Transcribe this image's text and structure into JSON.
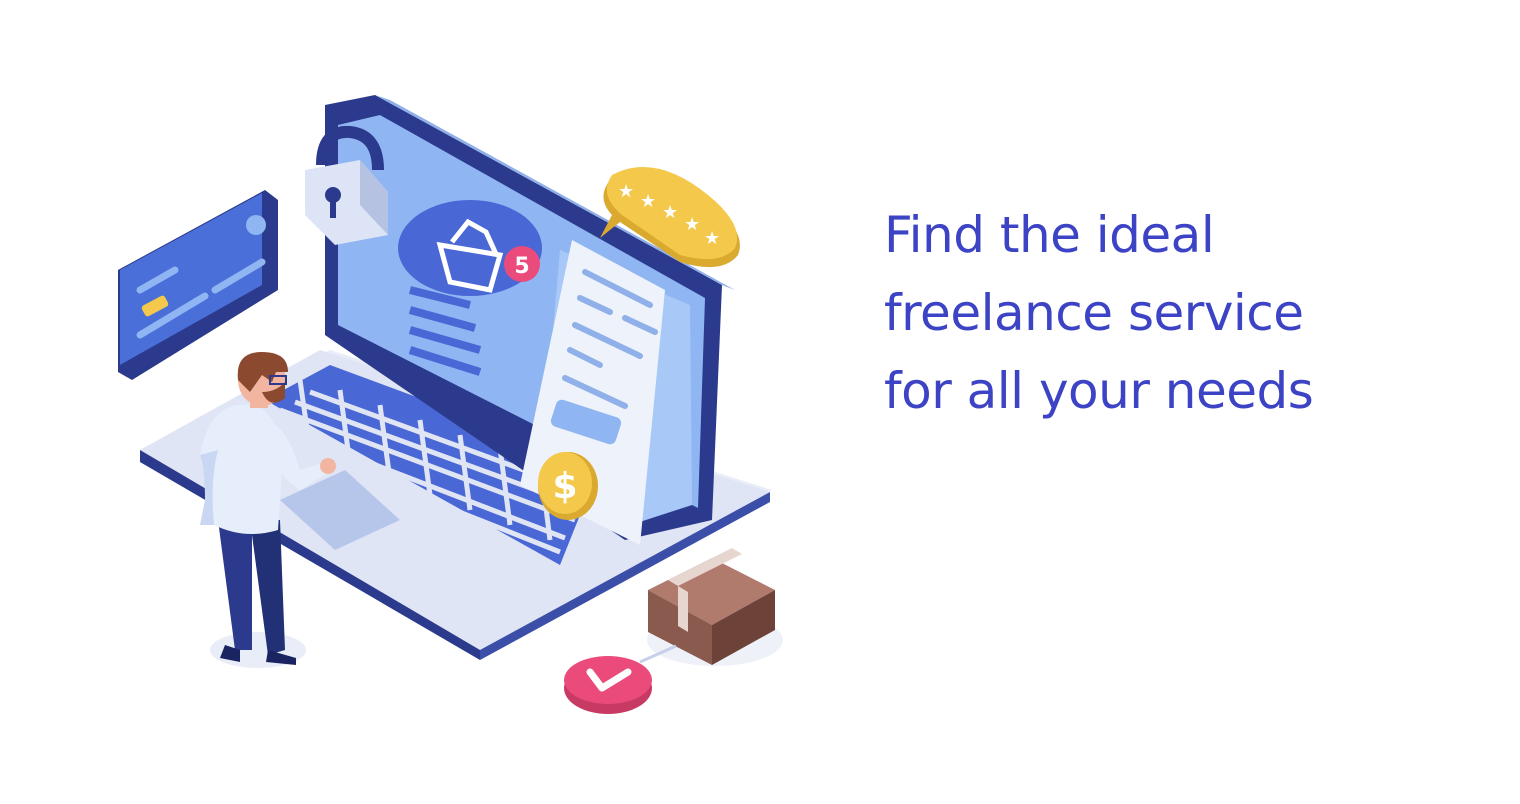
{
  "headline": {
    "line1": "Find the ideal",
    "line2": "freelance service",
    "line3": "for all your needs"
  },
  "illustration": {
    "cart_badge_count": "5",
    "currency_symbol": "$",
    "rating_stars": 5,
    "colors": {
      "headline": "#3c43c4",
      "laptop_dark": "#2b3a8c",
      "screen": "#8fb6f2",
      "keys": "#4a67d6",
      "card": "#4a6fd8",
      "coin": "#f4c84a",
      "badge": "#ea4b7a",
      "box": "#8b5a4e"
    },
    "icons": [
      "lock-icon",
      "credit-card-icon",
      "shopping-basket-icon",
      "dollar-coin-icon",
      "star-rating-icon",
      "package-box-icon",
      "checkmark-icon",
      "person-figure"
    ]
  }
}
